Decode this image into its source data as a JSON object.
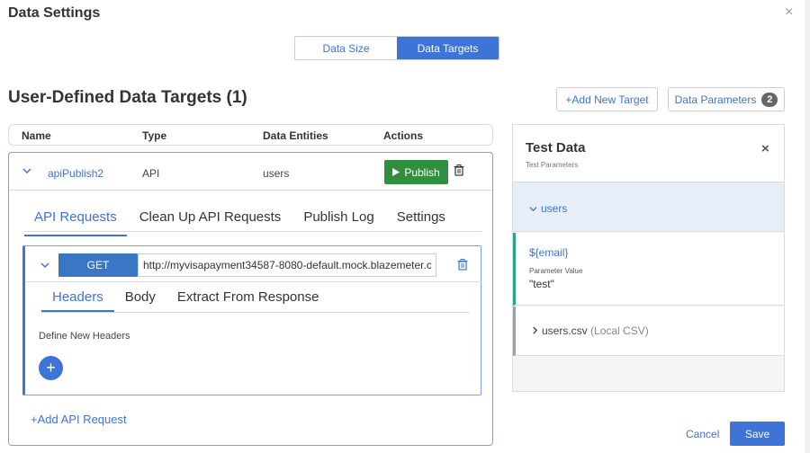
{
  "modal": {
    "title": "Data Settings",
    "close_icon": "×"
  },
  "segmented": {
    "data_size": "Data Size",
    "data_targets": "Data Targets",
    "active": "data_targets"
  },
  "section": {
    "title": "User-Defined Data Targets (1)"
  },
  "toolbar": {
    "add_target": "+Add New Target",
    "data_parameters": "Data Parameters",
    "data_parameters_count": "2"
  },
  "table": {
    "headers": {
      "name": "Name",
      "type": "Type",
      "entities": "Data Entities",
      "actions": "Actions"
    },
    "row": {
      "name": "apiPublish2",
      "type": "API",
      "entities": "users",
      "publish_label": "Publish"
    }
  },
  "target_tabs": [
    {
      "label": "API Requests",
      "active": true
    },
    {
      "label": "Clean Up API Requests",
      "active": false
    },
    {
      "label": "Publish Log",
      "active": false
    },
    {
      "label": "Settings",
      "active": false
    }
  ],
  "request": {
    "method": "GET",
    "url": "http://myvisapayment34587-8080-default.mock.blazemeter.c",
    "subtabs": [
      {
        "label": "Headers",
        "active": true
      },
      {
        "label": "Body",
        "active": false
      },
      {
        "label": "Extract From Response",
        "active": false
      }
    ],
    "define_headers": "Define New Headers",
    "add_header_icon": "+"
  },
  "add_api_request": "+Add API Request",
  "test_panel": {
    "title": "Test Data",
    "subtitle": "Test Parameters",
    "users_label": "users",
    "param_name": "${email}",
    "param_value_label": "Parameter Value",
    "param_value": "\"test\"",
    "csv_name": "users.csv",
    "csv_type": "(Local CSV)"
  },
  "footer": {
    "cancel": "Cancel",
    "save": "Save"
  },
  "colors": {
    "accent": "#3e73d8",
    "publish": "#2f8f3f",
    "param_border": "#2aa58a"
  }
}
